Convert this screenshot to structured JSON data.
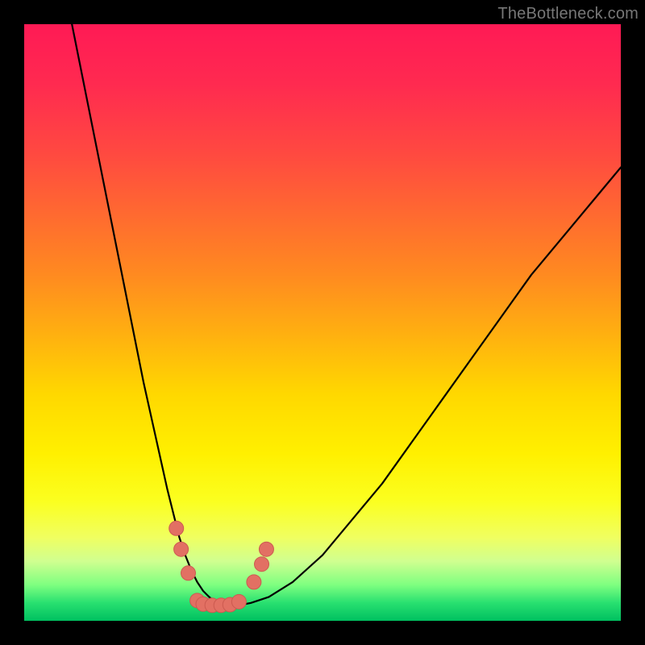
{
  "watermark": "TheBottleneck.com",
  "colors": {
    "background": "#000000",
    "curve_stroke": "#000000",
    "marker_fill": "#e27063",
    "marker_stroke": "#cc5a50"
  },
  "chart_data": {
    "type": "line",
    "title": "",
    "xlabel": "",
    "ylabel": "",
    "xlim": [
      0,
      100
    ],
    "ylim": [
      0,
      100
    ],
    "grid": false,
    "legend": false,
    "series": [
      {
        "name": "bottleneck-curve",
        "x": [
          8,
          10,
          12,
          14,
          16,
          18,
          20,
          22,
          24,
          25,
          26,
          27,
          28,
          29,
          30,
          31,
          32,
          33,
          34,
          36,
          38,
          41,
          45,
          50,
          55,
          60,
          65,
          70,
          75,
          80,
          85,
          90,
          95,
          100
        ],
        "y": [
          100,
          90,
          80,
          70,
          60,
          50,
          40,
          31,
          22,
          18,
          14,
          11,
          8.5,
          6.5,
          5,
          4,
          3.2,
          2.8,
          2.6,
          2.6,
          3,
          4,
          6.5,
          11,
          17,
          23,
          30,
          37,
          44,
          51,
          58,
          64,
          70,
          76
        ]
      }
    ],
    "markers": [
      {
        "x": 25.5,
        "y": 15.5
      },
      {
        "x": 26.3,
        "y": 12.0
      },
      {
        "x": 27.5,
        "y": 8.0
      },
      {
        "x": 29.0,
        "y": 3.4
      },
      {
        "x": 30.0,
        "y": 2.8
      },
      {
        "x": 31.5,
        "y": 2.6
      },
      {
        "x": 33.0,
        "y": 2.6
      },
      {
        "x": 34.5,
        "y": 2.7
      },
      {
        "x": 36.0,
        "y": 3.2
      },
      {
        "x": 38.5,
        "y": 6.5
      },
      {
        "x": 39.8,
        "y": 9.5
      },
      {
        "x": 40.6,
        "y": 12.0
      }
    ]
  }
}
